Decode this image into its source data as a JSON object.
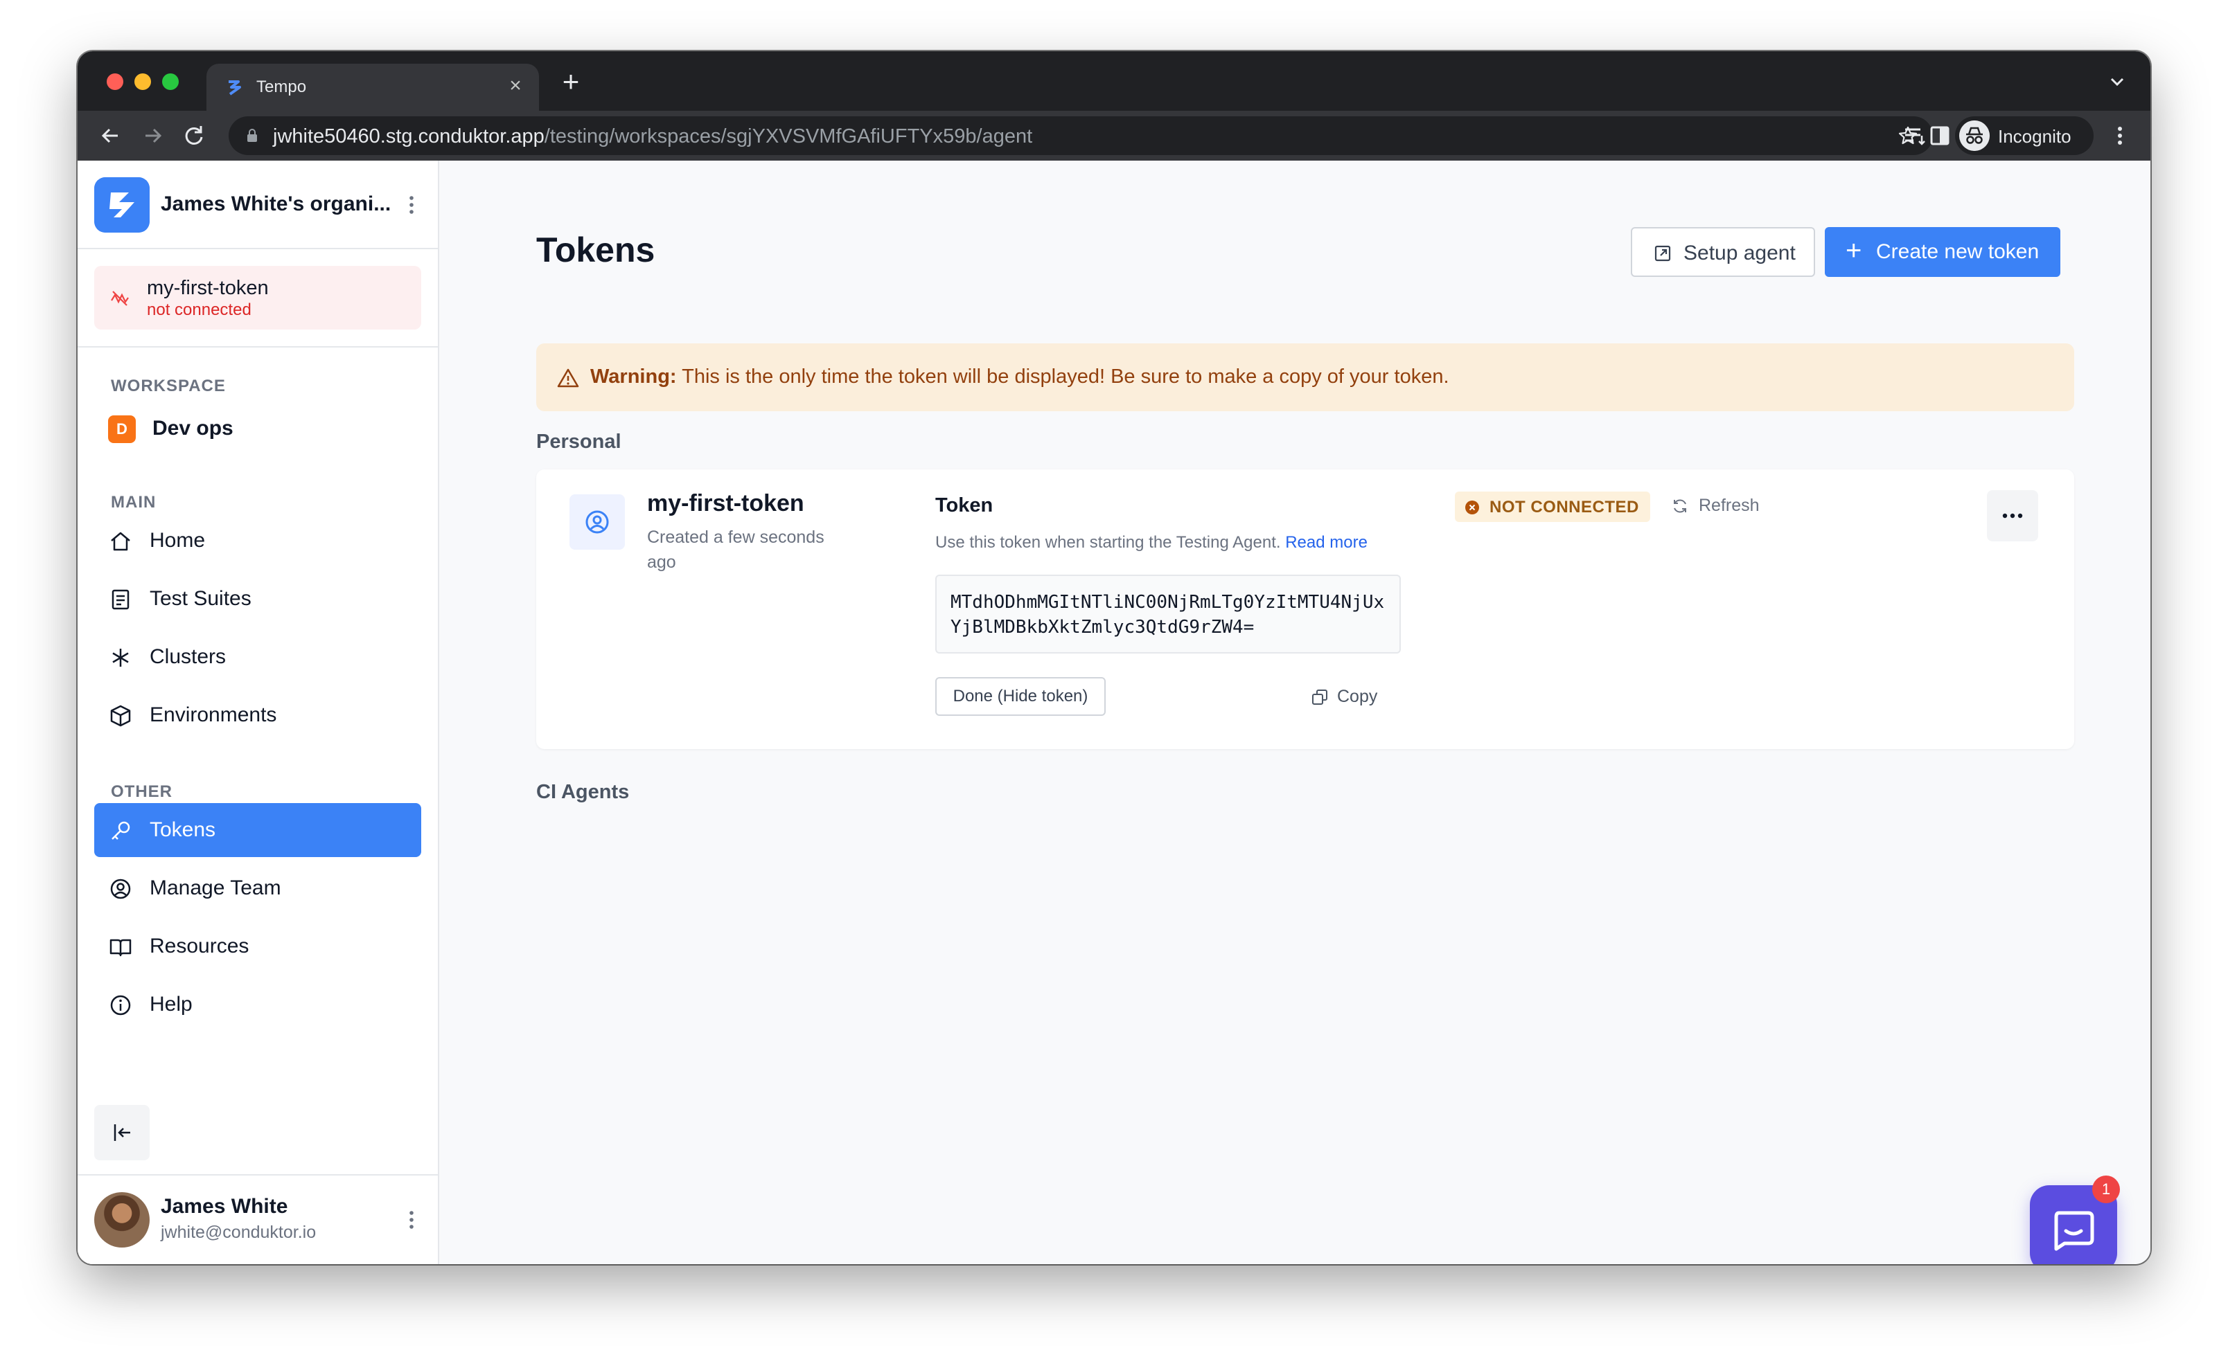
{
  "browser": {
    "tab_title": "Tempo",
    "url_host": "jwhite50460.stg.conduktor.app",
    "url_path": "/testing/workspaces/sgjYXVSVMfGAfiUFTYx59b/agent",
    "profile_label": "Incognito"
  },
  "sidebar": {
    "org_name": "James White's organi...",
    "connection": {
      "name": "my-first-token",
      "status": "not connected"
    },
    "workspace_label": "WORKSPACE",
    "workspace": {
      "badge": "D",
      "name": "Dev ops"
    },
    "main_label": "MAIN",
    "main_items": [
      {
        "label": "Home",
        "icon": "home-icon"
      },
      {
        "label": "Test Suites",
        "icon": "list-icon"
      },
      {
        "label": "Clusters",
        "icon": "asterisk-icon"
      },
      {
        "label": "Environments",
        "icon": "cube-icon"
      }
    ],
    "other_label": "OTHER",
    "other_items": [
      {
        "label": "Tokens",
        "icon": "key-icon",
        "active": true
      },
      {
        "label": "Manage Team",
        "icon": "user-circle-icon"
      },
      {
        "label": "Resources",
        "icon": "book-icon"
      },
      {
        "label": "Help",
        "icon": "info-icon"
      }
    ],
    "user": {
      "name": "James White",
      "email": "jwhite@conduktor.io"
    }
  },
  "main": {
    "title": "Tokens",
    "setup_agent_label": "Setup agent",
    "create_token_label": "Create new token",
    "warning": {
      "strong": "Warning:",
      "text": " This is the only time the token will be displayed! Be sure to make a copy of your token."
    },
    "personal_label": "Personal",
    "token": {
      "name": "my-first-token",
      "created": "Created a few seconds ago",
      "heading": "Token",
      "hint": "Use this token when starting the Testing Agent.",
      "read_more": "Read more",
      "value": "MTdhODhmMGItNTliNC00NjRmLTg0YzItMTU4NjUxYjBlMDBkbXktZmlyc3QtdG9rZW4=",
      "done_label": "Done (Hide token)",
      "copy_label": "Copy",
      "status": "NOT CONNECTED",
      "refresh_label": "Refresh"
    },
    "ci_agents_label": "CI Agents"
  },
  "chat": {
    "badge_count": "1"
  },
  "colors": {
    "accent": "#3b82f6",
    "warning_bg": "#fbeedb",
    "danger": "#dc2626",
    "chat": "#5b4de0"
  }
}
